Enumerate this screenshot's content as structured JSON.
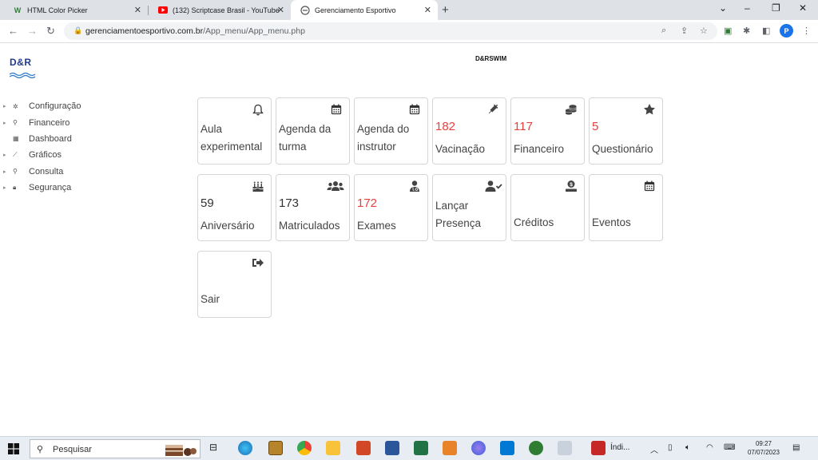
{
  "browser": {
    "tabs": [
      {
        "title": "HTML Color Picker",
        "favicon": "w-icon"
      },
      {
        "title": "(132) Scriptcase Brasil - YouTube",
        "favicon": "youtube-icon"
      },
      {
        "title": "Gerenciamento Esportivo",
        "favicon": "scriptcase-icon",
        "active": true
      }
    ],
    "url_host": "gerenciamentoesportivo.com.br",
    "url_path": "/App_menu/App_menu.php",
    "profile_initial": "P"
  },
  "app": {
    "logo_text": "D&R",
    "title": "D&RSWIM"
  },
  "sidebar": {
    "items": [
      {
        "label": "Configuração",
        "icon": "gear-icon",
        "expandable": true
      },
      {
        "label": "Financeiro",
        "icon": "search-icon",
        "expandable": true
      },
      {
        "label": "Dashboard",
        "icon": "dashboard-icon",
        "expandable": false
      },
      {
        "label": "Gráficos",
        "icon": "chart-icon",
        "expandable": true
      },
      {
        "label": "Consulta",
        "icon": "search-icon",
        "expandable": true
      },
      {
        "label": "Segurança",
        "icon": "lock-icon",
        "expandable": true
      }
    ]
  },
  "cards": [
    {
      "label1": "Aula",
      "label2": "experimental",
      "icon": "bell-icon"
    },
    {
      "label1": "Agenda da",
      "label2": "turma",
      "icon": "calendar-icon"
    },
    {
      "label1": "Agenda do",
      "label2": "instrutor",
      "icon": "calendar-icon"
    },
    {
      "number": "182",
      "label": "Vacinação",
      "icon": "syringe-icon",
      "number_color": "#e8403c"
    },
    {
      "number": "117",
      "label": "Financeiro",
      "icon": "coins-icon",
      "number_color": "#e8403c"
    },
    {
      "number": "5",
      "label": "Questionário",
      "icon": "star-icon",
      "number_color": "#e8403c"
    },
    {
      "number": "59",
      "label": "Aniversário",
      "icon": "birthday-cake-icon"
    },
    {
      "number": "173",
      "label": "Matriculados",
      "icon": "users-icon"
    },
    {
      "number": "172",
      "label": "Exames",
      "icon": "doctor-icon",
      "number_color": "#e8403c"
    },
    {
      "label1": "Lançar",
      "label2": "Presença",
      "icon": "user-check-icon"
    },
    {
      "label": "Créditos",
      "icon": "money-user-icon"
    },
    {
      "label": "Eventos",
      "icon": "calendar-icon"
    },
    {
      "label": "Sair",
      "icon": "sign-out-icon"
    }
  ],
  "taskbar": {
    "search_placeholder": "Pesquisar",
    "app_label": "Índi...",
    "time": "09:27",
    "date": "07/07/2023"
  },
  "colors": {
    "accent_red": "#e8403c",
    "logo_blue": "#1f3a8a"
  }
}
